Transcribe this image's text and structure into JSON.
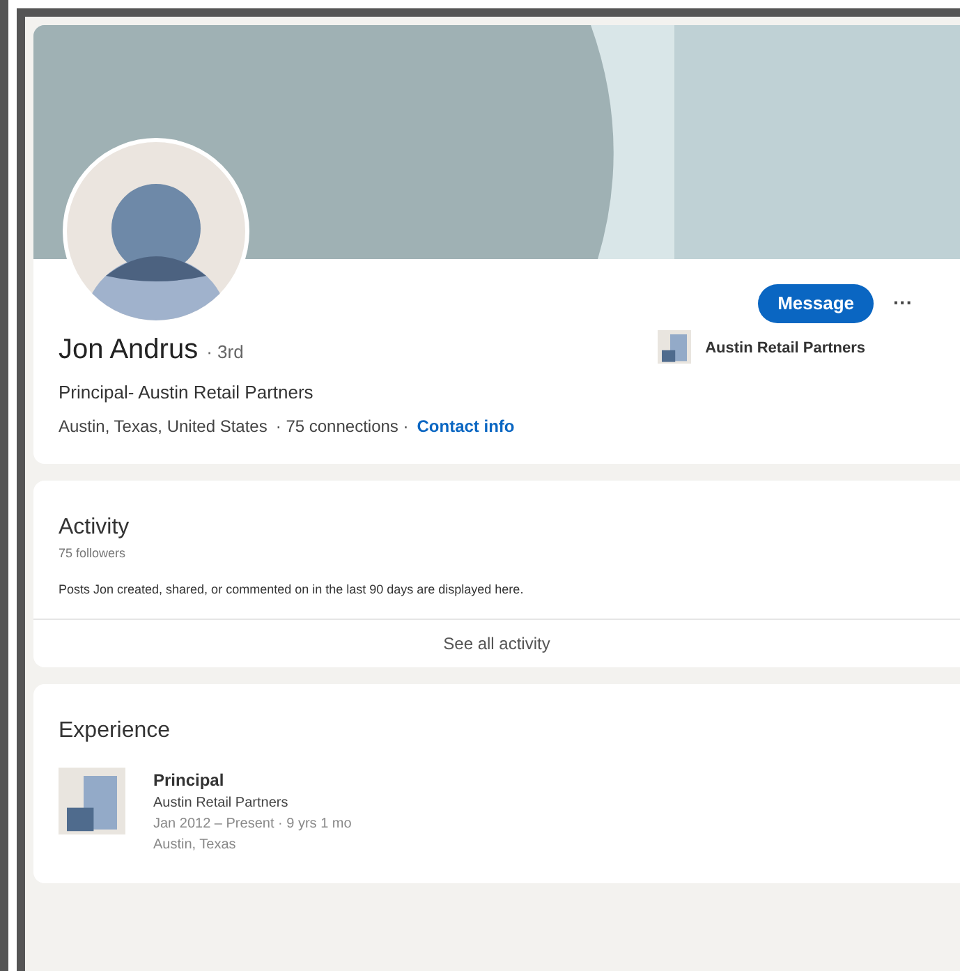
{
  "profile": {
    "name": "Jon Andrus",
    "degree": "· 3rd",
    "headline": "Principal- Austin Retail Partners",
    "location": "Austin, Texas, United States",
    "connections": "· 75 connections ·",
    "contact_link": "Contact info",
    "message_button": "Message",
    "more_button": "···",
    "current_company": "Austin Retail Partners"
  },
  "activity": {
    "title": "Activity",
    "followers": "75 followers",
    "description": "Posts Jon created, shared, or commented on in the last 90 days are displayed here.",
    "see_all": "See all activity"
  },
  "experience": {
    "title": "Experience",
    "items": [
      {
        "title": "Principal",
        "company": "Austin Retail Partners",
        "dates": "Jan 2012 – Present · 9 yrs 1 mo",
        "location": "Austin, Texas"
      }
    ]
  }
}
